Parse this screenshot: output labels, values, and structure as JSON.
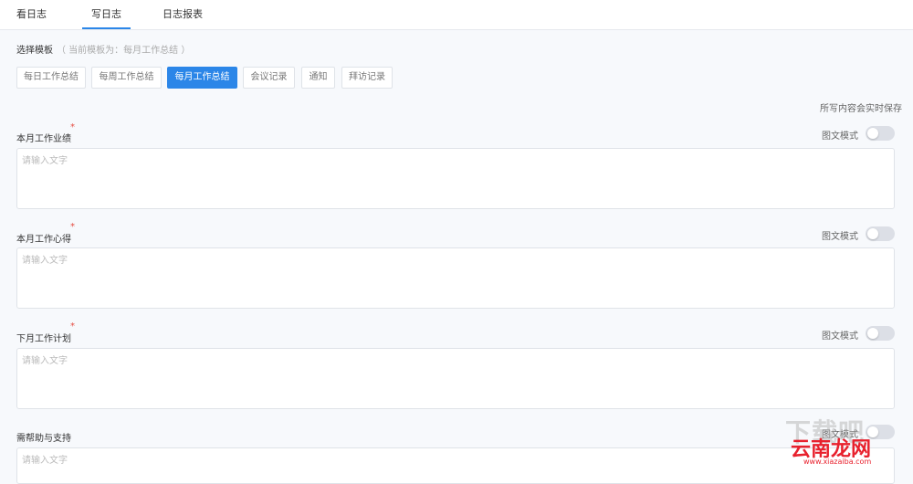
{
  "tabs": [
    {
      "label": "看日志",
      "active": false
    },
    {
      "label": "写日志",
      "active": true
    },
    {
      "label": "日志报表",
      "active": false
    }
  ],
  "template": {
    "label": "选择模板",
    "current_note": "（ 当前模板为：每月工作总结 ）",
    "options": [
      "每日工作总结",
      "每周工作总结",
      "每月工作总结",
      "会议记录",
      "通知",
      "拜访记录"
    ],
    "selected": "每月工作总结"
  },
  "autosave_text": "所写内容会实时保存",
  "fields": [
    {
      "label": "本月工作业绩",
      "required": true,
      "mode_label": "图文模式",
      "mode_on": false,
      "placeholder": "请输入文字"
    },
    {
      "label": "本月工作心得",
      "required": true,
      "mode_label": "图文模式",
      "mode_on": false,
      "placeholder": "请输入文字"
    },
    {
      "label": "下月工作计划",
      "required": true,
      "mode_label": "图文模式",
      "mode_on": false,
      "placeholder": "请输入文字"
    },
    {
      "label": "需帮助与支持",
      "required": false,
      "mode_label": "图文模式",
      "mode_on": false,
      "placeholder": "请输入文字"
    }
  ],
  "required_mark": "*",
  "watermark": {
    "big": "下载吧",
    "brand": "云南龙网",
    "url": "www.xiazaiba.com"
  },
  "colors": {
    "accent": "#2b86e8",
    "required": "#e54d42",
    "watermark_brand": "#e8212d"
  }
}
